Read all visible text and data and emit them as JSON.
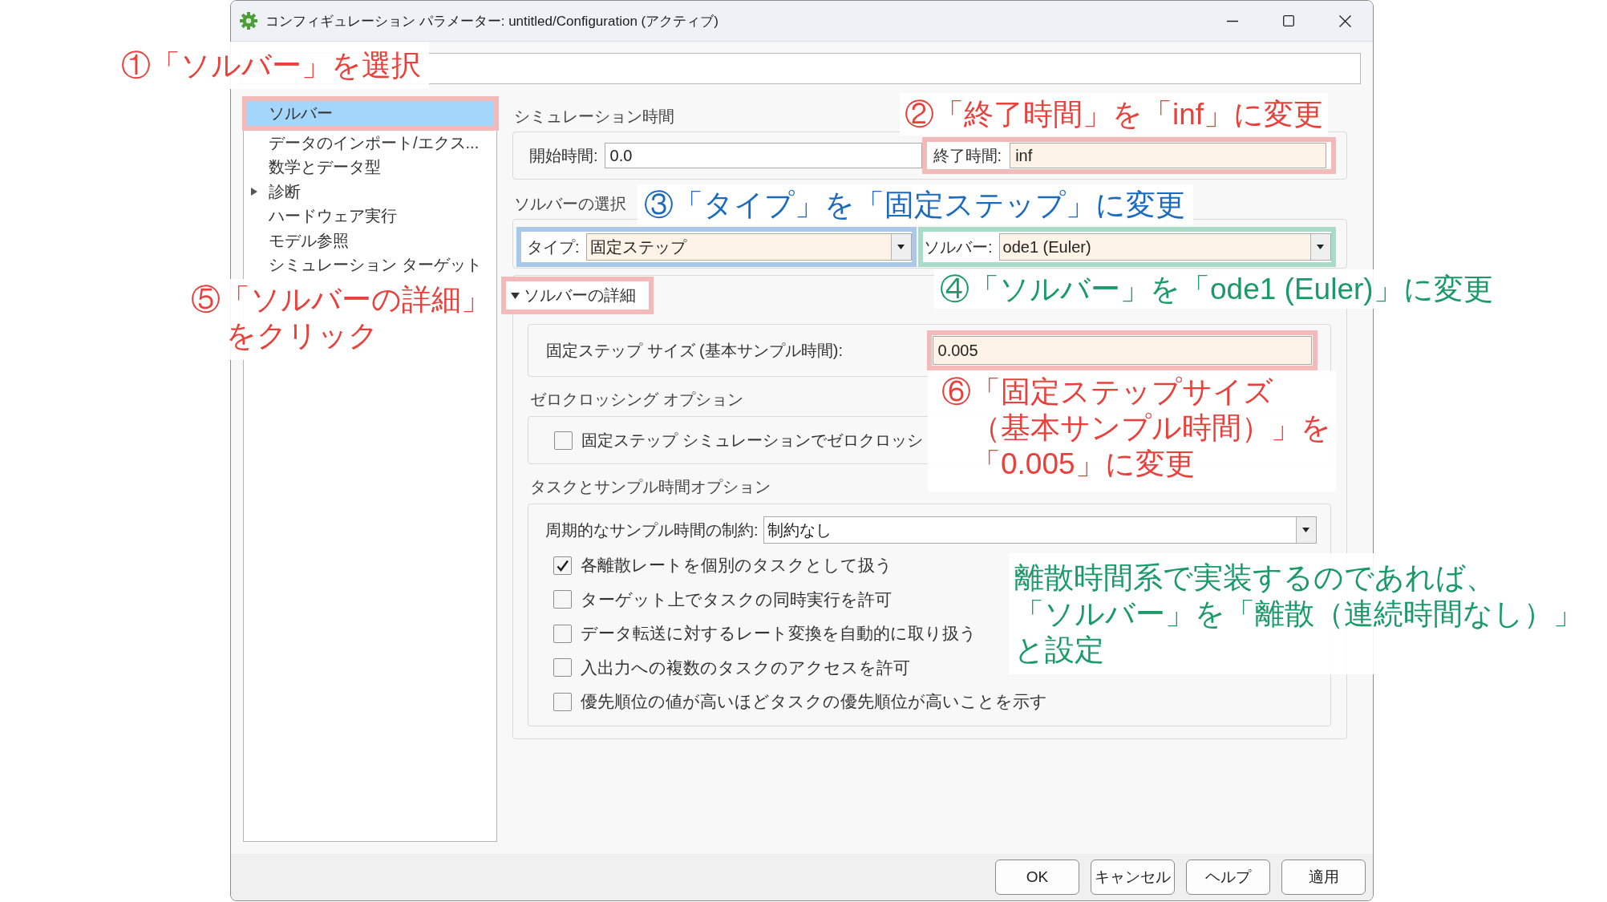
{
  "window": {
    "title": "コンフィギュレーション パラメーター: untitled/Configuration (アクティブ)"
  },
  "sidebar": {
    "items": [
      {
        "label": "ソルバー",
        "kind": "leaf",
        "selected": true,
        "frame": {
          "color": "#f4b9b9"
        }
      },
      {
        "label": "データのインポート/エクス...",
        "kind": "leaf",
        "selected": false
      },
      {
        "label": "数学とデータ型",
        "kind": "leaf",
        "selected": false
      },
      {
        "label": "診断",
        "kind": "branch",
        "expanded": false,
        "selected": false
      },
      {
        "label": "ハードウェア実行",
        "kind": "leaf",
        "selected": false
      },
      {
        "label": "モデル参照",
        "kind": "leaf",
        "selected": false
      },
      {
        "label": "シミュレーション ターゲット",
        "kind": "leaf",
        "selected": false
      }
    ]
  },
  "simulation_time": {
    "title": "シミュレーション時間",
    "fields": [
      {
        "label": "開始時間:",
        "value": "0.0",
        "modified": false
      },
      {
        "label": "終了時間:",
        "value": "inf",
        "modified": true,
        "frame": {
          "color": "#f4b9b9"
        }
      }
    ]
  },
  "solver_selection": {
    "title": "ソルバーの選択",
    "fields": [
      {
        "label": "タイプ:",
        "value": "固定ステップ",
        "modified": true,
        "frame": {
          "color": "#a9c8ea"
        }
      },
      {
        "label": "ソルバー:",
        "value": "ode1 (Euler)",
        "modified": true,
        "frame": {
          "color": "#a8dcc6"
        }
      }
    ]
  },
  "solver_details": {
    "label": "ソルバーの詳細",
    "expanded": true,
    "frame": {
      "color": "#f4b9b9"
    },
    "step_size": {
      "label": "固定ステップ サイズ (基本サンプル時間):",
      "value": "0.005",
      "modified": true,
      "frame": {
        "color": "#f4b9b9"
      }
    },
    "zero_crossing": {
      "title": "ゼロクロッシング オプション",
      "options": [
        {
          "label": "固定ステップ シミュレーションでゼロクロッシ",
          "checked": false
        }
      ]
    },
    "tasks": {
      "title": "タスクとサンプル時間オプション",
      "constraint": {
        "label": "周期的なサンプル時間の制約:",
        "value": "制約なし",
        "modified": false
      },
      "options": [
        {
          "label": "各離散レートを個別のタスクとして扱う",
          "checked": true
        },
        {
          "label": "ターゲット上でタスクの同時実行を許可",
          "checked": false
        },
        {
          "label": "データ転送に対するレート変換を自動的に取り扱う",
          "checked": false
        },
        {
          "label": "入出力への複数のタスクのアクセスを許可",
          "checked": false
        },
        {
          "label": "優先順位の値が高いほどタスクの優先順位が高いことを示す",
          "checked": false
        }
      ]
    }
  },
  "buttons": [
    "OK",
    "キャンセル",
    "ヘルプ",
    "適用"
  ],
  "callouts": [
    {
      "lines": [
        "①「ソルバー」を選択"
      ],
      "color": "#e8413c"
    },
    {
      "lines": [
        "②「終了時間」を「inf」に変更"
      ],
      "color": "#e8413c"
    },
    {
      "lines": [
        "③「タイプ」を「固定ステップ」に変更"
      ],
      "color": "#1a6bbf"
    },
    {
      "lines": [
        "⑤「ソルバーの詳細」",
        "をクリック"
      ],
      "color": "#e8413c"
    },
    {
      "lines": [
        "④「ソルバー」を「ode1 (Euler)」に変更"
      ],
      "color": "#1a9a68"
    },
    {
      "lines": [
        "⑥「固定ステップサイズ",
        "（基本サンプル時間）」を",
        "「0.005」に変更"
      ],
      "color": "#e8413c"
    },
    {
      "lines": [
        "離散時間系で実装するのであれば、",
        "「ソルバー」を「離散（連続時間なし）」",
        "と設定"
      ],
      "color": "#1a9a68"
    }
  ]
}
